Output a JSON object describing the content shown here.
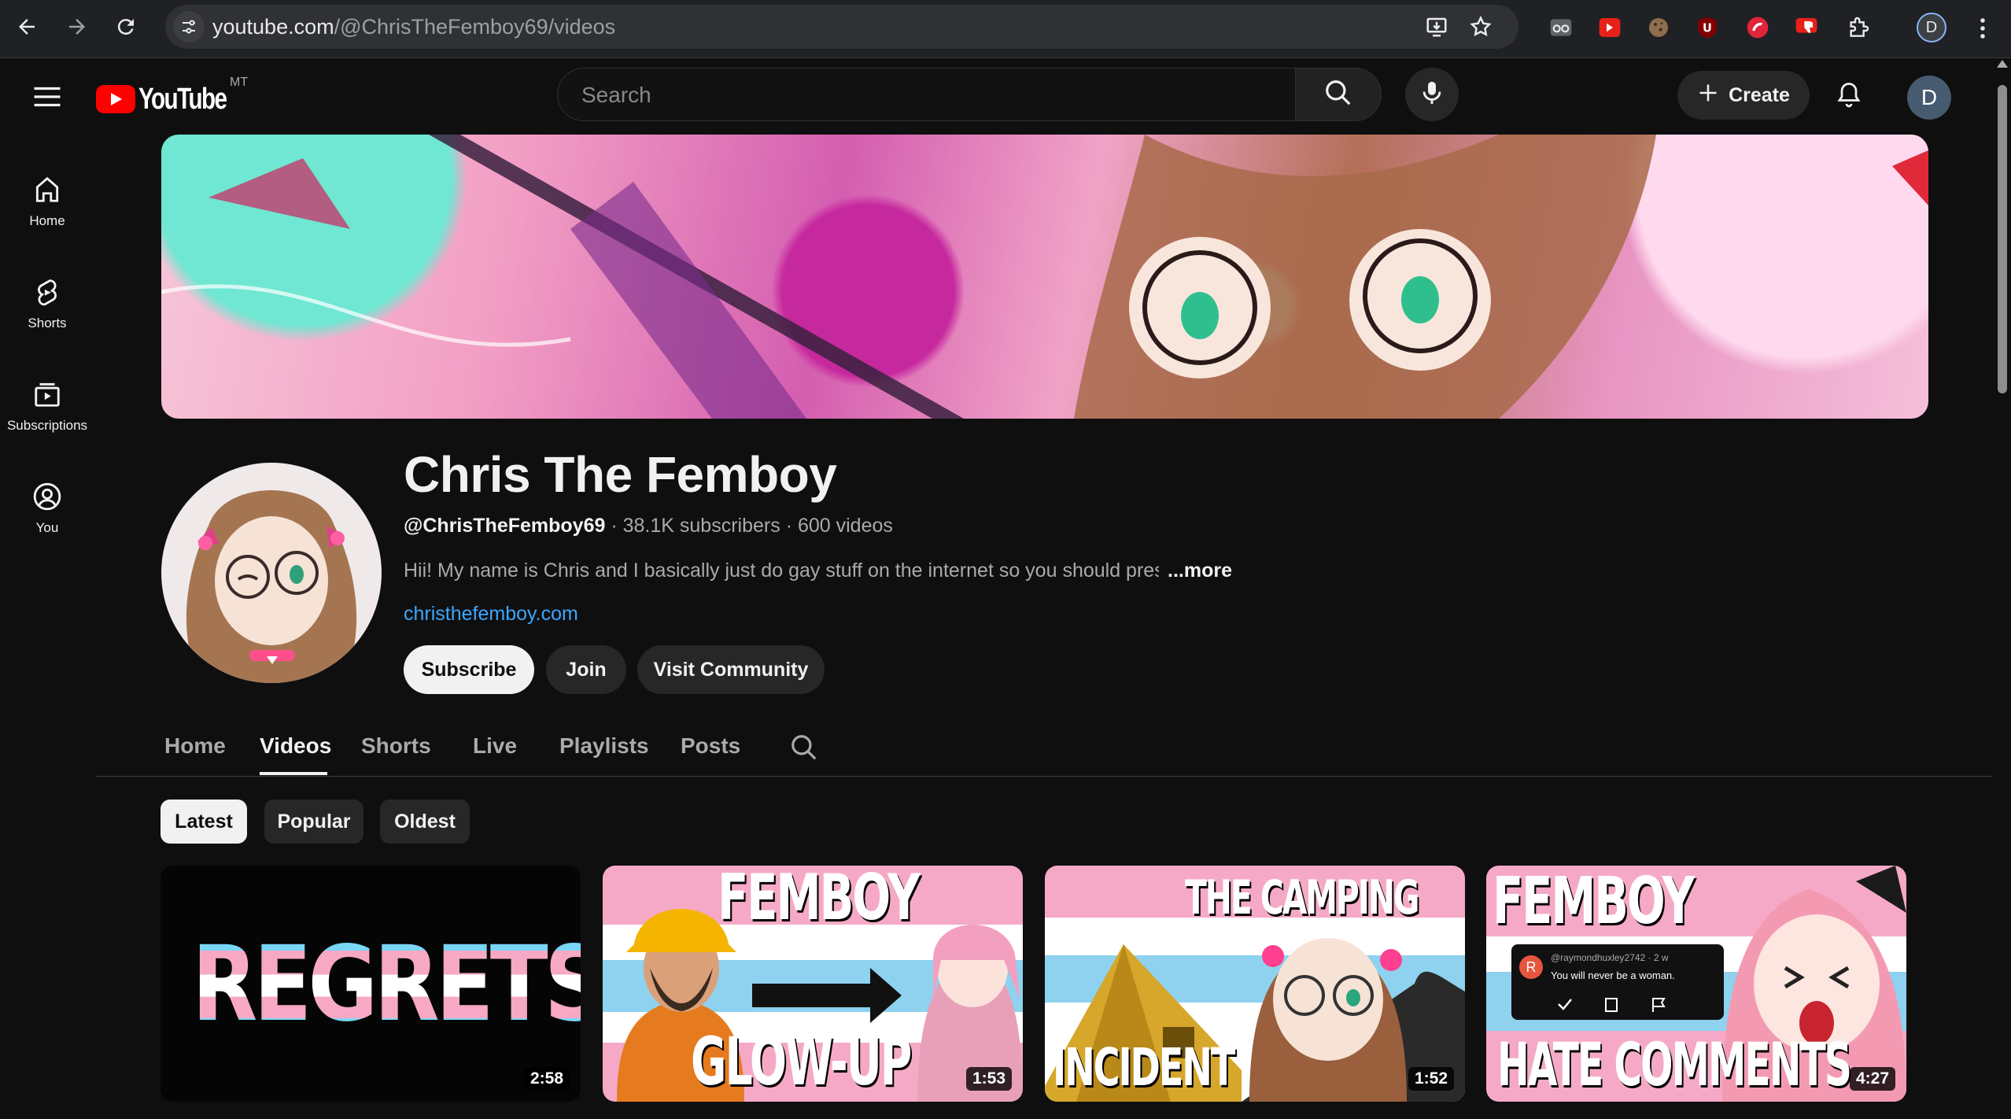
{
  "browser": {
    "url_host": "youtube.com",
    "url_path": "/@ChrisTheFemboy69/videos",
    "profile_initial": "D",
    "icons": [
      "back-arrow-icon",
      "forward-arrow-icon",
      "reload-icon",
      "site-info-icon",
      "install-app-icon",
      "bookmark-star-icon",
      "extensions-puzzle-icon",
      "kebab-menu-icon"
    ],
    "extensions": [
      "reader-ext-icon",
      "youtube-red-ext-icon",
      "cookie-ext-icon",
      "ublock-ext-icon",
      "red-circle-ext-icon",
      "dislike-ext-icon"
    ]
  },
  "masthead": {
    "logo_text": "YouTube",
    "country_code": "MT",
    "search_placeholder": "Search",
    "create_label": "Create",
    "avatar_initial": "D"
  },
  "guide": {
    "items": [
      {
        "label": "Home",
        "icon": "home-icon"
      },
      {
        "label": "Shorts",
        "icon": "shorts-icon"
      },
      {
        "label": "Subscriptions",
        "icon": "subscriptions-icon"
      },
      {
        "label": "You",
        "icon": "you-icon"
      }
    ]
  },
  "channel": {
    "name": "Chris The Femboy",
    "handle": "@ChrisTheFemboy69",
    "subscribers": "38.1K subscribers",
    "videos_count": "600 videos",
    "description": "Hii! My name is Chris and I basically just do gay stuff on the internet so you should press",
    "more_label": "...more",
    "link": "christhefemboy.com",
    "subscribe_label": "Subscribe",
    "join_label": "Join",
    "community_label": "Visit Community"
  },
  "tabs": {
    "items": [
      "Home",
      "Videos",
      "Shorts",
      "Live",
      "Playlists",
      "Posts"
    ],
    "active": "Videos"
  },
  "chips": {
    "items": [
      "Latest",
      "Popular",
      "Oldest"
    ],
    "selected": "Latest"
  },
  "videos": [
    {
      "thumb_text": [
        "REGRETS"
      ],
      "duration": "2:58"
    },
    {
      "thumb_text": [
        "FEMBOY",
        "GLOW-UP"
      ],
      "duration": "1:53"
    },
    {
      "thumb_text": [
        "THE CAMPING",
        "INCIDENT"
      ],
      "duration": "1:52"
    },
    {
      "thumb_text": [
        "FEMBOY",
        "HATE COMMENTS"
      ],
      "comment_user": "@raymondhuxley2742 · 2 w",
      "comment_text": "You will never be a woman.",
      "comment_avatar": "R",
      "duration": "4:27"
    }
  ],
  "colors": {
    "background": "#0f0f0f",
    "brand_red": "#ff0000",
    "link_blue": "#3ea6ff",
    "chip_selected": "#f1f1f1",
    "chip_bg": "#272727"
  }
}
